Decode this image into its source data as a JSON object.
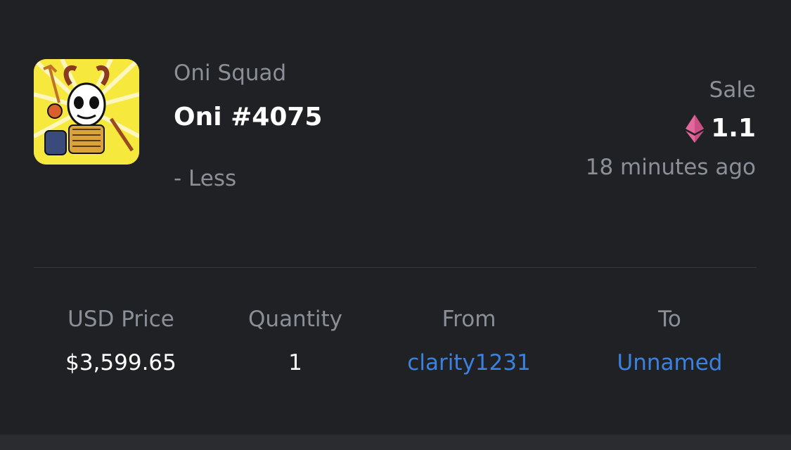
{
  "item": {
    "collection": "Oni Squad",
    "name": "Oni #4075",
    "toggle_label": "- Less",
    "thumbnail_icon": "oni-nft-thumbnail"
  },
  "event": {
    "type": "Sale",
    "price": "1.1",
    "currency_icon": "ethereum-icon",
    "time_ago": "18 minutes ago"
  },
  "details": {
    "usd_price": {
      "label": "USD Price",
      "value": "$3,599.65"
    },
    "quantity": {
      "label": "Quantity",
      "value": "1"
    },
    "from": {
      "label": "From",
      "value": "clarity1231"
    },
    "to": {
      "label": "To",
      "value": "Unnamed"
    }
  },
  "colors": {
    "background": "#202124",
    "primary_text": "#ffffff",
    "secondary_text": "#8a8f98",
    "link": "#3b82e0",
    "eth_pink": "#e2679a"
  }
}
